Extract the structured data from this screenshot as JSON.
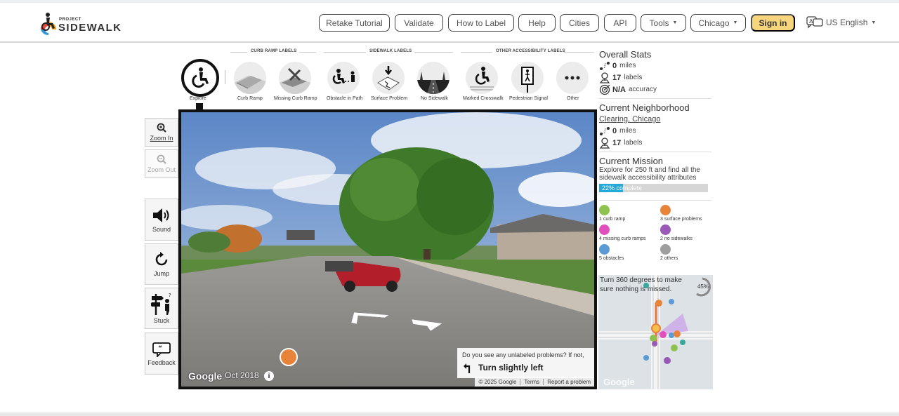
{
  "app": {
    "brand_line1": "PROJECT",
    "brand_line2": "SIDEWALK"
  },
  "nav": {
    "retake_tutorial": "Retake Tutorial",
    "validate": "Validate",
    "how_to_label": "How to Label",
    "help": "Help",
    "cities": "Cities",
    "api": "API",
    "tools": "Tools",
    "city": "Chicago",
    "sign_in": "Sign in",
    "language": "US English"
  },
  "label_sections": {
    "curb_ramp": "CURB RAMP LABELS",
    "sidewalk": "SIDEWALK LABELS",
    "other": "OTHER ACCESSIBILITY LABELS"
  },
  "label_buttons": {
    "explore": "Explore",
    "curb_ramp": "Curb Ramp",
    "missing_curb_ramp": "Missing Curb Ramp",
    "obstacle": "Obstacle in Path",
    "surface_problem": "Surface Problem",
    "no_sidewalk": "No Sidewalk",
    "marked_crosswalk": "Marked Crosswalk",
    "pedestrian_signal": "Pedestrian Signal",
    "other": "Other"
  },
  "tools": {
    "zoom_in": "Zoom In",
    "zoom_out": "Zoom Out",
    "sound": "Sound",
    "jump": "Jump",
    "stuck": "Stuck",
    "feedback": "Feedback"
  },
  "panorama": {
    "google": "Google",
    "date": "Oct 2018",
    "copyright": "© 2025 Google",
    "terms": "Terms",
    "report": "Report a problem",
    "hint_question": "Do you see any unlabeled problems? If not,",
    "hint_direction": "Turn slightly left"
  },
  "overall_stats": {
    "title": "Overall Stats",
    "miles": "0",
    "miles_unit": "miles",
    "labels": "17",
    "labels_unit": "labels",
    "accuracy": "N/A",
    "accuracy_unit": "accuracy"
  },
  "neighborhood": {
    "title": "Current Neighborhood",
    "name": "Clearing, Chicago",
    "miles": "0",
    "miles_unit": "miles",
    "labels": "17",
    "labels_unit": "labels"
  },
  "mission": {
    "title": "Current Mission",
    "description": "Explore for 250 ft and find all the sidewalk accessibility attributes",
    "progress_text": "22% complete",
    "progress_percent": 22
  },
  "label_counts": {
    "curb_ramp": "1 curb ramp",
    "surface_problems": "3 surface problems",
    "missing_curb_ramps": "4 missing curb ramps",
    "no_sidewalks": "2 no sidewalks",
    "obstacles": "5 obstacles",
    "others": "2 others"
  },
  "minimap": {
    "message": "Turn 360 degrees to make sure nothing is missed.",
    "percent": "45%",
    "google": "Google"
  },
  "colors": {
    "signin": "#f7d57d",
    "progress": "#26a8d8",
    "curb_ramp": "#8fc34f",
    "missing_curb_ramp": "#e24fbd",
    "obstacle": "#5b9bd5",
    "surface_problem": "#e8833a",
    "no_sidewalk": "#9b59b6",
    "other": "#9e9e9e"
  }
}
